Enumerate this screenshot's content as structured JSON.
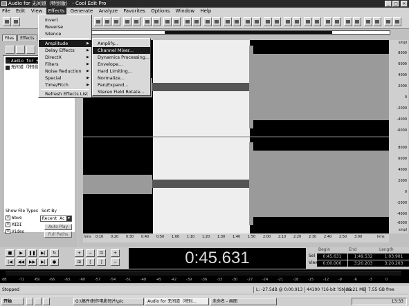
{
  "window": {
    "title": "Audio for 无间道（特别版） - Cool Edit Pro"
  },
  "menubar": [
    "File",
    "Edit",
    "View",
    "Effects",
    "Generate",
    "Analyze",
    "Favorites",
    "Options",
    "Window",
    "Help"
  ],
  "effects_menu": {
    "items": [
      "Invert",
      "Reverse",
      "Silence",
      "Amplitude",
      "Delay Effects",
      "DirectX",
      "Filters",
      "Noise Reduction",
      "Special",
      "Time/Pitch",
      "Refresh Effects List"
    ],
    "highlighted": "Amplitude"
  },
  "amplitude_submenu": {
    "items": [
      "Amplify...",
      "Channel Mixer...",
      "Dynamics Processing...",
      "Envelope...",
      "Hard Limiting...",
      "Normalize...",
      "Pan/Expand...",
      "Stereo Field Rotate..."
    ],
    "highlighted": "Channel Mixer..."
  },
  "left_panel": {
    "tabs": [
      "Files",
      "Effects"
    ],
    "files": [
      "Audio for 无间道",
      "无间道（特别版）"
    ],
    "show_file_types_label": "Show File Types",
    "sort_by_label": "Sort By",
    "file_types": [
      "Wave",
      "MIDI",
      "Video"
    ],
    "sort_value": "Recent Ac",
    "auto_play": "Auto Play",
    "full_paths": "Full Paths"
  },
  "waveform": {
    "amp_labels_top": [
      "smpl",
      "8000",
      "6000",
      "4000",
      "2000",
      "0",
      "-2000",
      "-4000",
      "-6000"
    ],
    "amp_labels_bottom": [
      "8000",
      "6000",
      "4000",
      "2000",
      "0",
      "-2000",
      "-4000",
      "-6000",
      "smpl"
    ],
    "time_labels": [
      "hms",
      "0:10",
      "0:20",
      "0:30",
      "0:40",
      "0:50",
      "1:00",
      "1:10",
      "1:20",
      "1:30",
      "1:40",
      "1:50",
      "2:00",
      "2:10",
      "2:20",
      "2:30",
      "2:40",
      "2:50",
      "3:00",
      "hms"
    ]
  },
  "time_display": "0:45.631",
  "selection_info": {
    "headers": [
      "Begin",
      "End",
      "Length"
    ],
    "sel_label": "Sel",
    "view_label": "View",
    "sel": [
      "0:45.631",
      "1:49.532",
      "1:03.901"
    ],
    "view": [
      "0:00.000",
      "3:20.203",
      "3:20.203"
    ]
  },
  "level_meter": [
    "dB",
    "-72",
    "-69",
    "-66",
    "-63",
    "-60",
    "-57",
    "-54",
    "-51",
    "-48",
    "-45",
    "-42",
    "-39",
    "-36",
    "-33",
    "-30",
    "-27",
    "-24",
    "-21",
    "-18",
    "-15",
    "-12",
    "-9",
    "-6",
    "-3",
    "0"
  ],
  "status": {
    "state": "Stopped",
    "cursor": "L: -27.5dB @ 0:00.913",
    "format": "44100 ?16-bit ?Stereo",
    "size": "35.21 MB",
    "free": "7.55 GB free"
  },
  "taskbar": {
    "start": "开始",
    "tasks": [
      "G:\\稿件\\制作电影短片\\pic",
      "Audio for 无间道（特别...",
      "未命名 - 画图"
    ],
    "clock": "13:33"
  }
}
